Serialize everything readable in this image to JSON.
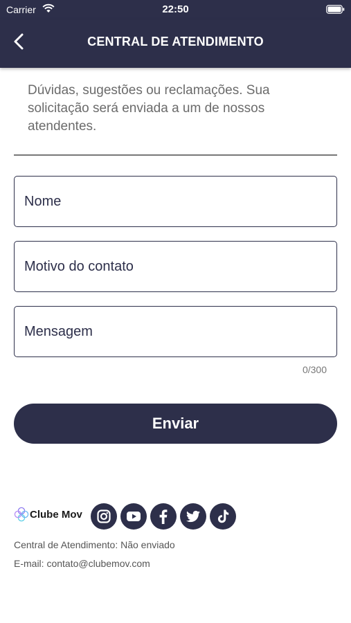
{
  "status_bar": {
    "carrier": "Carrier",
    "time": "22:50"
  },
  "header": {
    "title": "CENTRAL DE ATENDIMENTO",
    "back_icon": "chevron-left-icon"
  },
  "intro_text": "Dúvidas,  sugestões ou reclamações. Sua solicitação será enviada a um de nossos atendentes.",
  "form": {
    "name_placeholder": "Nome",
    "reason_placeholder": "Motivo do contato",
    "message_placeholder": "Mensagem",
    "char_counter": "0/300",
    "submit_label": "Enviar"
  },
  "footer": {
    "logo_text": "Clube Mov",
    "social_icons": [
      "instagram-icon",
      "youtube-icon",
      "facebook-icon",
      "twitter-icon",
      "tiktok-icon"
    ],
    "status_line": "Central de Atendimento: Não enviado",
    "email_line": "E-mail: contato@clubemov.com"
  },
  "colors": {
    "primary": "#2d2f4a",
    "background": "#ffffff",
    "muted_text": "#6b6b6b"
  }
}
